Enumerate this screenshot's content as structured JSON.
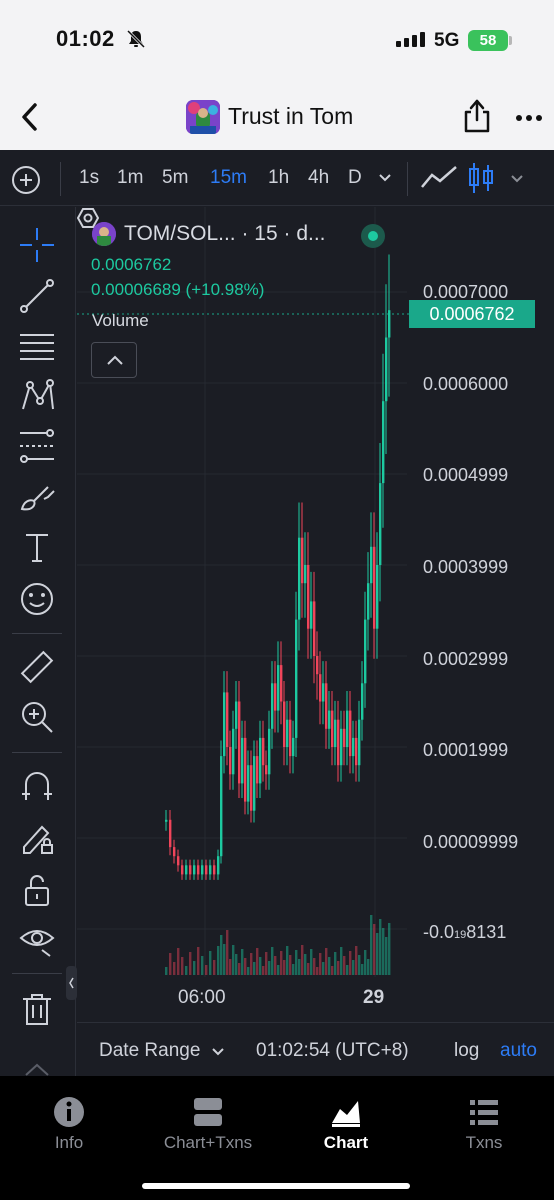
{
  "status_bar": {
    "time": "01:02",
    "network": "5G",
    "battery": "58"
  },
  "header": {
    "title": "Trust in Tom"
  },
  "toolbar": {
    "timeframes": [
      "1s",
      "1m",
      "5m",
      "15m",
      "1h",
      "4h",
      "D"
    ],
    "active_timeframe": "15m"
  },
  "chart": {
    "symbol": "TOM/SOL... · 15 · d...",
    "current_price": "0.0006762",
    "change_line": "0.00006689 (+10.98%)",
    "volume_label": "Volume",
    "price_tag": "0.0006762",
    "y_labels": [
      "0.0007000",
      "0.0006000",
      "0.0004999",
      "0.0003999",
      "0.0002999",
      "0.0001999",
      "0.00009999"
    ],
    "neg_label_prefix": "-0.0",
    "neg_label_sub": "19",
    "neg_label_suffix": "8131",
    "x_labels": [
      "06:00",
      "29"
    ]
  },
  "chart_data": {
    "type": "candlestick",
    "y_ticks": [
      0.0007,
      0.0006,
      0.0004999,
      0.0003999,
      0.0002999,
      0.0001999,
      9.999e-05
    ],
    "last_price": 0.0006762
  },
  "range_bar": {
    "date_range": "Date Range",
    "time": "01:02:54 (UTC+8)",
    "log": "log",
    "auto": "auto"
  },
  "tabs": [
    {
      "label": "Info"
    },
    {
      "label": "Chart+Txns"
    },
    {
      "label": "Chart"
    },
    {
      "label": "Txns"
    }
  ],
  "colors": {
    "up": "#1dc9a0",
    "down": "#f0455a",
    "accent": "#2d7cf6"
  }
}
